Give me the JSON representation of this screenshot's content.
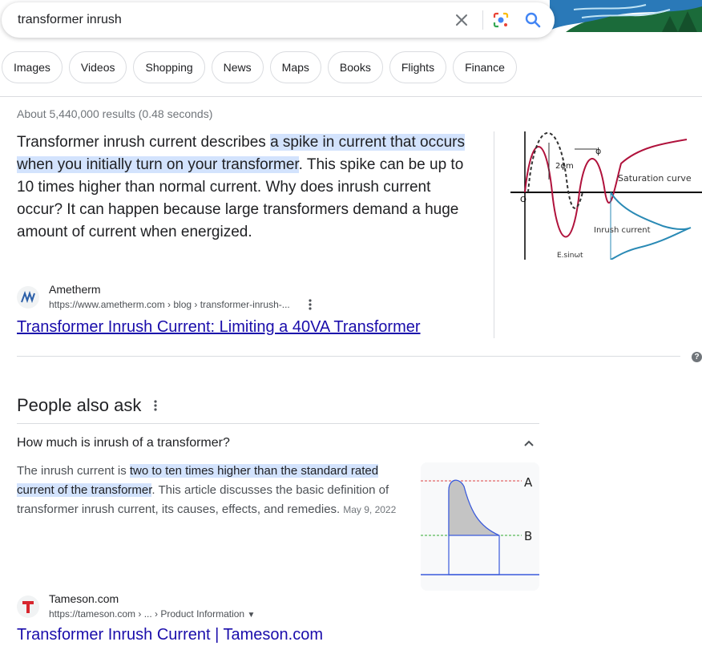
{
  "search": {
    "query": "transformer inrush"
  },
  "chips": [
    "Images",
    "Videos",
    "Shopping",
    "News",
    "Maps",
    "Books",
    "Flights",
    "Finance"
  ],
  "stats": "About 5,440,000 results (0.48 seconds)",
  "snippet": {
    "text_before": "Transformer inrush current describes ",
    "highlight": "a spike in current that occurs when you initially turn on your transformer",
    "text_after": ". This spike can be up to 10 times higher than normal current. Why does inrush current occur? It can happen because large transformers demand a huge amount of current when energized.",
    "image_labels": {
      "phi": "ϕ",
      "two_phi_m": "2ϕm",
      "saturation": "Saturation curve",
      "inrush": "Inrush current",
      "origin": "O",
      "esin": "E.sinωt"
    },
    "source": {
      "name": "Ametherm",
      "url": "https://www.ametherm.com › blog › transformer-inrush-..."
    },
    "link": "Transformer Inrush Current: Limiting a 40VA Transformer"
  },
  "paa": {
    "title": "People also ask",
    "question": "How much is inrush of a transformer?",
    "answer_before": "The inrush current is ",
    "answer_highlight": "two to ten times higher than the standard rated current of the transformer",
    "answer_after": ". This article discusses the basic definition of transformer inrush current, its causes, effects, and remedies.",
    "date": "May 9, 2022",
    "image_labels": {
      "a": "A",
      "b": "B"
    },
    "source": {
      "name": "Tameson.com",
      "url": "https://tameson.com › ... › Product Information"
    },
    "link": "Transformer Inrush Current | Tameson.com"
  },
  "colors": {
    "link": "#1a0dab",
    "highlight": "#d3e3fd",
    "search_icon": "#4285f4"
  }
}
